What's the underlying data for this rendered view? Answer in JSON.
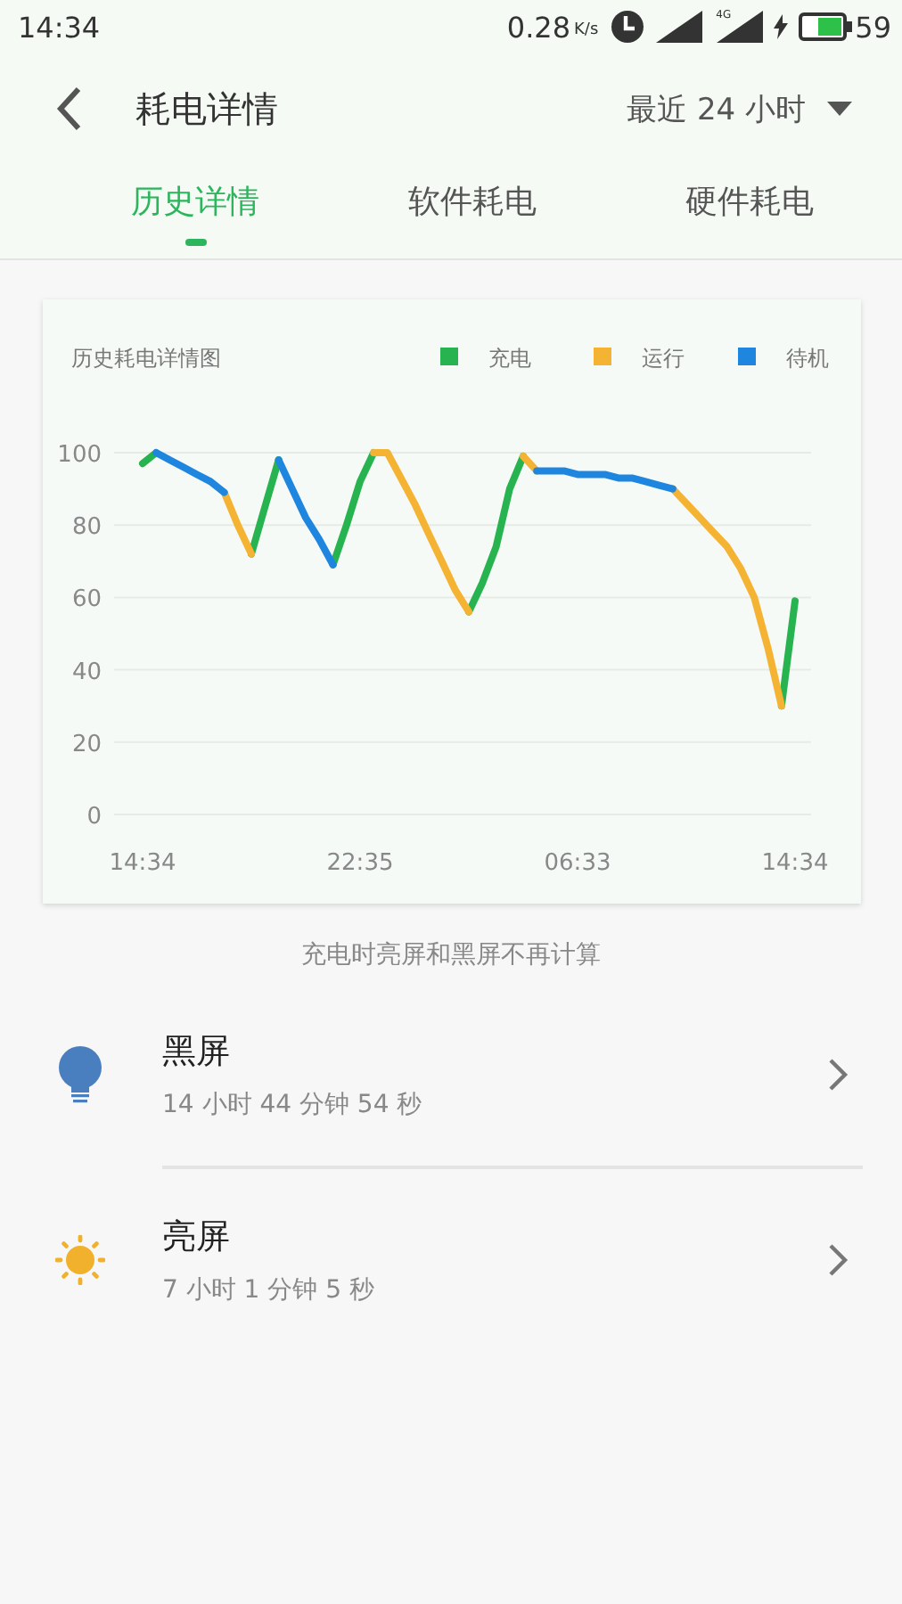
{
  "status_bar": {
    "time": "14:34",
    "speed": "0.28",
    "speed_unit": "K/s",
    "network": "4G",
    "battery": "59",
    "charging": true
  },
  "header": {
    "title": "耗电详情",
    "range": "最近 24 小时"
  },
  "tabs": [
    {
      "label": "历史详情",
      "selected": true
    },
    {
      "label": "软件耗电",
      "selected": false
    },
    {
      "label": "硬件耗电",
      "selected": false
    }
  ],
  "chart": {
    "chart_data": {
      "type": "line",
      "title": "历史耗电详情图",
      "categories": [
        "14:34",
        null,
        null,
        null,
        null,
        null,
        null,
        null,
        null,
        null,
        null,
        null,
        null,
        null,
        null,
        null,
        "22:35",
        null,
        null,
        null,
        null,
        null,
        null,
        null,
        null,
        null,
        null,
        null,
        null,
        null,
        null,
        null,
        "06:33",
        null,
        null,
        null,
        null,
        null,
        null,
        null,
        null,
        null,
        null,
        null,
        null,
        null,
        null,
        null,
        "14:34"
      ],
      "series": [
        {
          "name": "充电",
          "color": "#27b34f",
          "values": [
            97,
            100,
            null,
            null,
            null,
            null,
            null,
            null,
            72,
            85,
            98,
            null,
            null,
            null,
            69,
            80,
            92,
            100,
            null,
            null,
            null,
            null,
            null,
            null,
            56,
            64,
            74,
            90,
            99,
            null,
            null,
            null,
            null,
            null,
            null,
            null,
            null,
            null,
            null,
            null,
            null,
            null,
            null,
            null,
            null,
            null,
            null,
            30,
            59
          ]
        },
        {
          "name": "运行",
          "color": "#f5b334",
          "values": [
            null,
            null,
            null,
            null,
            null,
            null,
            89,
            80,
            72,
            null,
            null,
            null,
            null,
            null,
            null,
            null,
            null,
            100,
            100,
            93,
            86,
            78,
            70,
            62,
            56,
            null,
            null,
            null,
            99,
            95,
            null,
            null,
            null,
            null,
            null,
            null,
            null,
            null,
            null,
            90,
            86,
            82,
            78,
            74,
            68,
            60,
            46,
            30,
            null
          ]
        },
        {
          "name": "待机",
          "color": "#1f86e0",
          "values": [
            null,
            100,
            98,
            96,
            94,
            92,
            89,
            null,
            null,
            null,
            98,
            90,
            82,
            76,
            69,
            null,
            null,
            null,
            null,
            null,
            null,
            null,
            null,
            null,
            null,
            null,
            null,
            null,
            null,
            95,
            95,
            95,
            94,
            94,
            94,
            93,
            93,
            92,
            91,
            90,
            null,
            null,
            null,
            null,
            null,
            null,
            null,
            null,
            null
          ]
        }
      ],
      "ylim": [
        0,
        100
      ],
      "grid": true,
      "legend": "top",
      "yticks": [
        0,
        20,
        40,
        60,
        80,
        100
      ]
    }
  },
  "note": "充电时亮屏和黑屏不再计算",
  "items": [
    {
      "kind": "bulb",
      "title": "黑屏",
      "duration": "14 小时 44 分钟 54 秒"
    },
    {
      "kind": "sun",
      "title": "亮屏",
      "duration": "7 小时 1 分钟 5 秒"
    }
  ]
}
